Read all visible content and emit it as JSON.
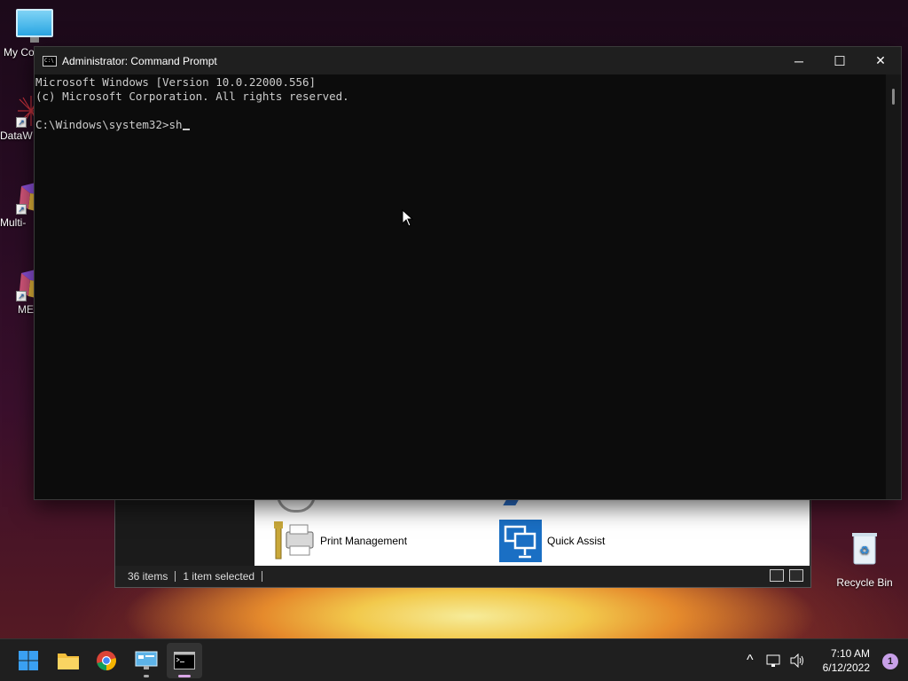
{
  "desktop": {
    "icons": [
      {
        "label": "My Co"
      },
      {
        "label": "DataW"
      },
      {
        "label": "Multi-"
      },
      {
        "label": "ME"
      },
      {
        "label": "Recycle Bin"
      }
    ]
  },
  "cmd_window": {
    "title": "Administrator: Command Prompt",
    "title_icon": "C:\\",
    "lines": [
      "Microsoft Windows [Version 10.0.22000.556]",
      "(c) Microsoft Corporation. All rights reserved."
    ],
    "prompt": "C:\\Windows\\system32>",
    "input": "sh",
    "controls": {
      "minimize": "─",
      "maximize": "☐",
      "close": "✕"
    }
  },
  "control_panel": {
    "items": [
      {
        "label": "Print Management",
        "icon": "printer-icon"
      },
      {
        "label": "Quick Assist",
        "icon": "quick-assist-icon"
      }
    ],
    "status": {
      "items": "36 items",
      "selected": "1 item selected"
    }
  },
  "taskbar": {
    "apps": [
      "start-icon",
      "file-explorer-icon",
      "chrome-icon",
      "control-panel-icon",
      "command-prompt-icon"
    ],
    "clock": {
      "time": "7:10 AM",
      "date": "6/12/2022"
    },
    "notification_count": "1",
    "tray_chevron": "^"
  }
}
